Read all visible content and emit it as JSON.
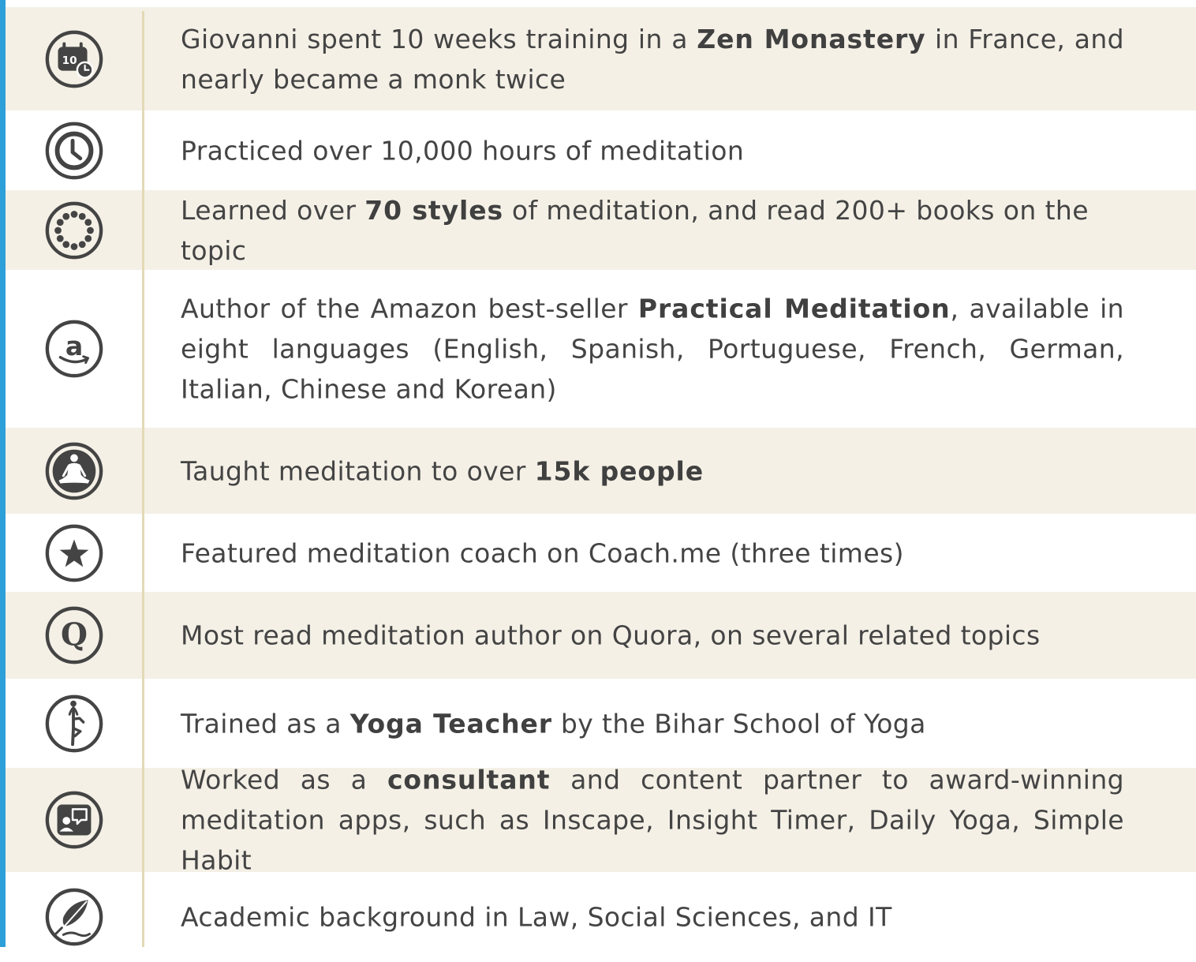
{
  "rows": [
    {
      "icon": "calendar-10-icon",
      "icon_text": "10",
      "before": "Giovanni spent 10 weeks training in a ",
      "bold": "Zen Monastery",
      "after": " in France, and nearly became a monk twice"
    },
    {
      "icon": "clock-icon",
      "before": "Practiced over 10,000 hours of meditation",
      "bold": "",
      "after": ""
    },
    {
      "icon": "beads-circle-icon",
      "before": "Learned over ",
      "bold": "70 styles",
      "after": " of meditation, and read 200+ books on the topic"
    },
    {
      "icon": "amazon-icon",
      "icon_text": "a",
      "before": "Author of the Amazon best-seller ",
      "bold": "Practical Meditation",
      "after": ", available in eight languages (English, Spanish, Portuguese, French, German, Italian, Chinese and Korean)"
    },
    {
      "icon": "meditation-figure-icon",
      "before": "Taught meditation to over ",
      "bold": "15k people",
      "after": ""
    },
    {
      "icon": "star-icon",
      "before": "Featured meditation coach on Coach.me (three times)",
      "bold": "",
      "after": ""
    },
    {
      "icon": "quora-icon",
      "icon_text": "Q",
      "before": "Most read meditation author on Quora, on several related topics",
      "bold": "",
      "after": ""
    },
    {
      "icon": "yoga-pose-icon",
      "before": "Trained as a ",
      "bold": "Yoga Teacher",
      "after": " by the Bihar School of Yoga"
    },
    {
      "icon": "consultant-chat-icon",
      "before": "Worked as a ",
      "bold": "consultant",
      "after": " and content partner to award-winning meditation apps, such as Inscape, Insight Timer, Daily Yoga, Simple Habit"
    },
    {
      "icon": "quill-pen-icon",
      "before": "Academic background in Law, Social Sciences, and IT",
      "bold": "",
      "after": ""
    }
  ],
  "colors": {
    "accent_bar": "#2d9fd9",
    "shaded_row": "#f4f0e6",
    "divider": "#e3d9b6",
    "text": "#444444",
    "icon": "#444444"
  }
}
